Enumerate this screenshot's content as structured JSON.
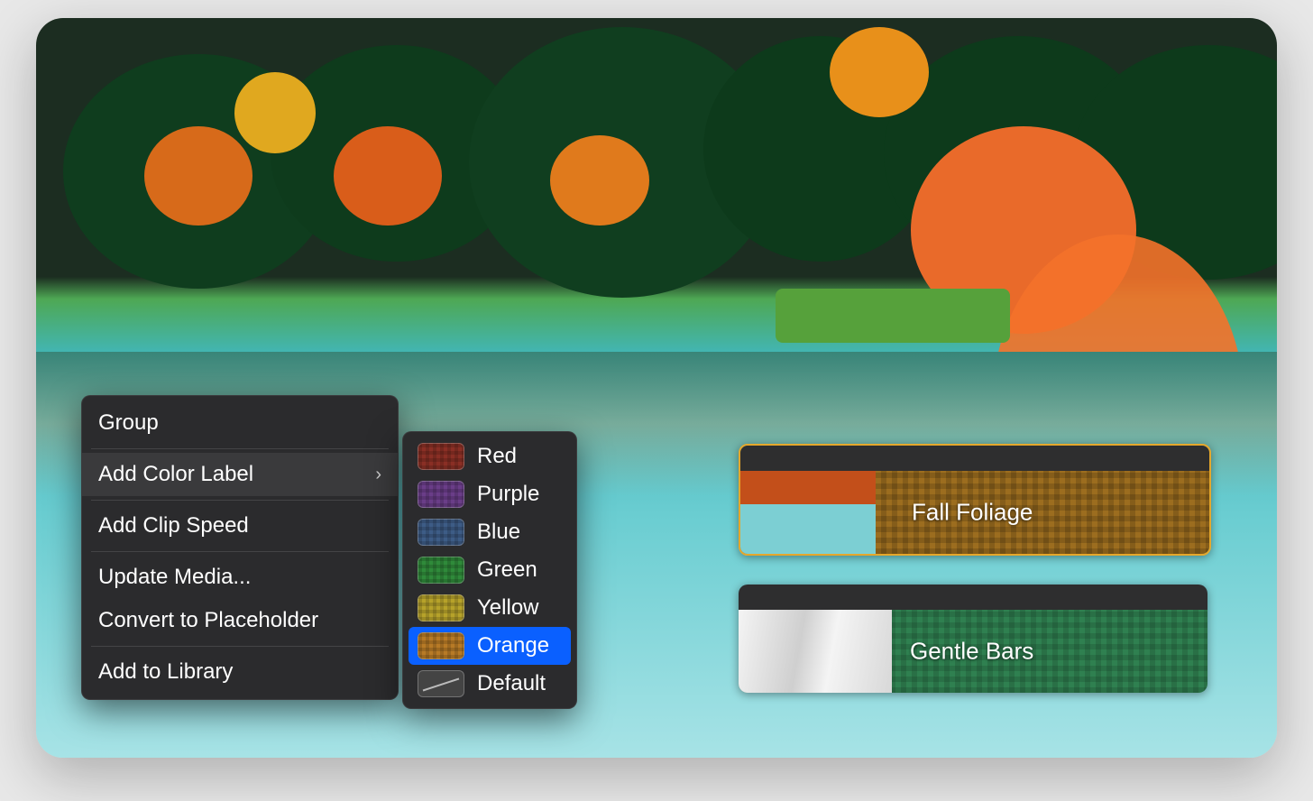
{
  "context_menu": {
    "group": "Group",
    "add_color_label": "Add Color Label",
    "add_clip_speed": "Add Clip Speed",
    "update_media": "Update Media...",
    "convert_to_placeholder": "Convert to Placeholder",
    "add_to_library": "Add to Library"
  },
  "color_submenu": {
    "red": "Red",
    "purple": "Purple",
    "blue": "Blue",
    "green": "Green",
    "yellow": "Yellow",
    "orange": "Orange",
    "default": "Default",
    "selected": "Orange"
  },
  "colors": {
    "red": "#8a2f25",
    "purple": "#6a3d88",
    "blue": "#3d5c86",
    "green": "#2f8a3a",
    "yellow": "#b6a22a",
    "orange": "#b77a26"
  },
  "clips": {
    "fall_foliage": {
      "name": "Fall Foliage",
      "color_label": "Orange",
      "selected": true
    },
    "gentle_bars": {
      "name": "Gentle Bars",
      "color_label": "Green",
      "selected": false
    }
  }
}
